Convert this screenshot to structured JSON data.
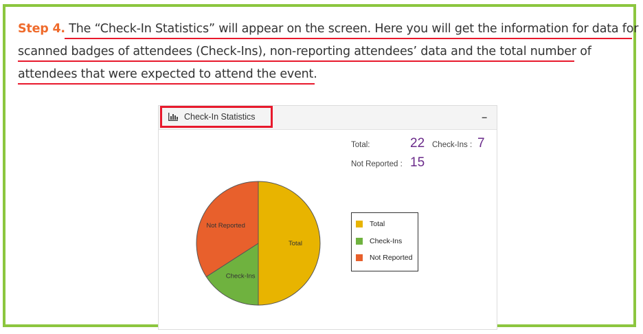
{
  "instructions": {
    "step_label": "Step 4.",
    "line1_rest": " The “Check-In Statistics” will appear on the screen. Here you will get the information for data for",
    "line2": "scanned badges of attendees (Check-Ins), non-reporting attendees’ data and the total number of",
    "line3": "attendees that were expected to attend the event."
  },
  "widget": {
    "title": "Check-In Statistics",
    "title_icon": "bar-chart-icon",
    "collapse_label": "–",
    "stats": {
      "total_label": "Total:",
      "total_value": "22",
      "checkins_label": "Check-Ins :",
      "checkins_value": "7",
      "not_reported_label": "Not Reported :",
      "not_reported_value": "15"
    },
    "legend": [
      {
        "label": "Total",
        "color": "#e8b400"
      },
      {
        "label": "Check-Ins",
        "color": "#6fb23f"
      },
      {
        "label": "Not Reported",
        "color": "#e8602c"
      }
    ]
  },
  "chart_data": {
    "type": "pie",
    "slices": [
      {
        "label": "Total",
        "value": 22,
        "color": "#e8b400"
      },
      {
        "label": "Check-Ins",
        "value": 7,
        "color": "#6fb23f"
      },
      {
        "label": "Not Reported",
        "value": 15,
        "color": "#e8602c"
      }
    ],
    "legend_position": "right"
  },
  "colors": {
    "frame_border": "#8cc63f",
    "underline": "#e8192c",
    "step_accent": "#ef6b2c",
    "stat_number": "#6a2a8a"
  }
}
